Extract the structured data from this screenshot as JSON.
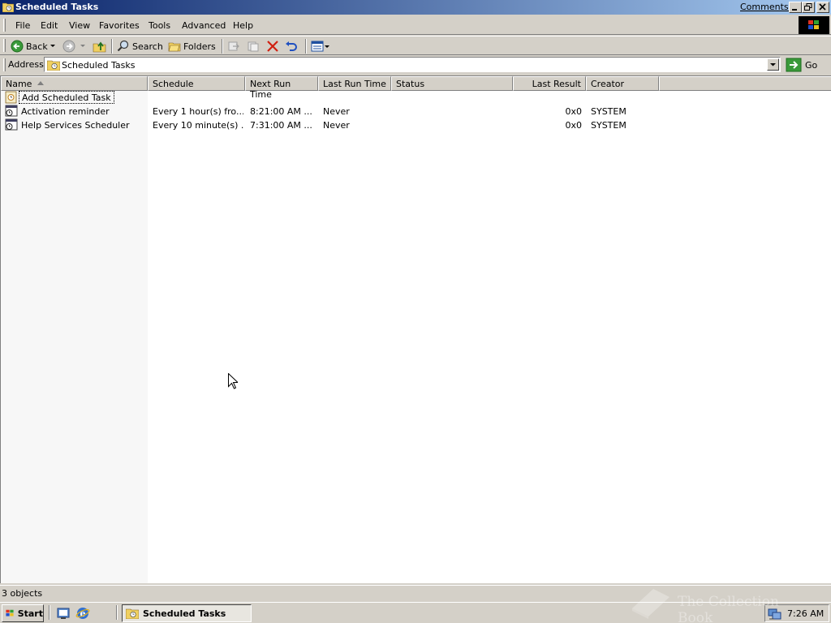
{
  "window": {
    "title": "Scheduled Tasks",
    "comments_link": "Comments?"
  },
  "menu": [
    "File",
    "Edit",
    "View",
    "Favorites",
    "Tools",
    "Advanced",
    "Help"
  ],
  "toolbar": {
    "back_label": "Back",
    "search_label": "Search",
    "folders_label": "Folders"
  },
  "address": {
    "label": "Address",
    "value": "Scheduled Tasks",
    "go_label": "Go"
  },
  "columns": [
    "Name",
    "Schedule",
    "Next Run Time",
    "Last Run Time",
    "Status",
    "Last Result",
    "Creator"
  ],
  "rows": [
    {
      "name": "Add Scheduled Task",
      "schedule": "",
      "next_run": "",
      "last_run": "",
      "status": "",
      "last_result": "",
      "creator": ""
    },
    {
      "name": "Activation reminder",
      "schedule": "Every 1 hour(s) fro...",
      "next_run": "8:21:00 AM  ...",
      "last_run": "Never",
      "status": "",
      "last_result": "0x0",
      "creator": "SYSTEM"
    },
    {
      "name": "Help Services Scheduler",
      "schedule": "Every 10 minute(s) ...",
      "next_run": "7:31:00 AM  ...",
      "last_run": "Never",
      "status": "",
      "last_result": "0x0",
      "creator": "SYSTEM"
    }
  ],
  "status_bar": {
    "text": "3 objects"
  },
  "taskbar": {
    "start_label": "Start",
    "task_label": "Scheduled Tasks",
    "clock": "7:26 AM"
  },
  "watermark": "The Collection Book",
  "colors": {
    "title_gradient_start": "#0a246a",
    "title_gradient_end": "#a6caf0",
    "face": "#d4d0c8"
  }
}
